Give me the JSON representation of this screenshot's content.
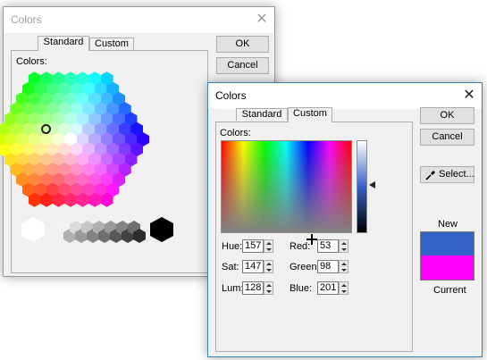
{
  "dialog_back": {
    "title": "Colors",
    "tabs": [
      "Standard",
      "Custom"
    ],
    "colors_label": "Colors:",
    "ok_label": "OK",
    "cancel_label": "Cancel"
  },
  "dialog_front": {
    "title": "Colors",
    "tabs": [
      "Standard",
      "Custom"
    ],
    "colors_label": "Colors:",
    "ok_label": "OK",
    "cancel_label": "Cancel",
    "select_label": "Select...",
    "new_label": "New",
    "current_label": "Current",
    "fields": {
      "hue": {
        "label": "Hue:",
        "value": "157"
      },
      "sat": {
        "label": "Sat:",
        "value": "147"
      },
      "lum": {
        "label": "Lum:",
        "value": "128"
      },
      "red": {
        "label": "Red:",
        "value": "53"
      },
      "green": {
        "label": "Green:",
        "value": "98"
      },
      "blue": {
        "label": "Blue:",
        "value": "201"
      }
    },
    "new_color": "#3562c9",
    "current_color": "#ff00ff"
  },
  "icons": {
    "close": "close-icon",
    "eyedropper": "eyedropper-icon"
  }
}
